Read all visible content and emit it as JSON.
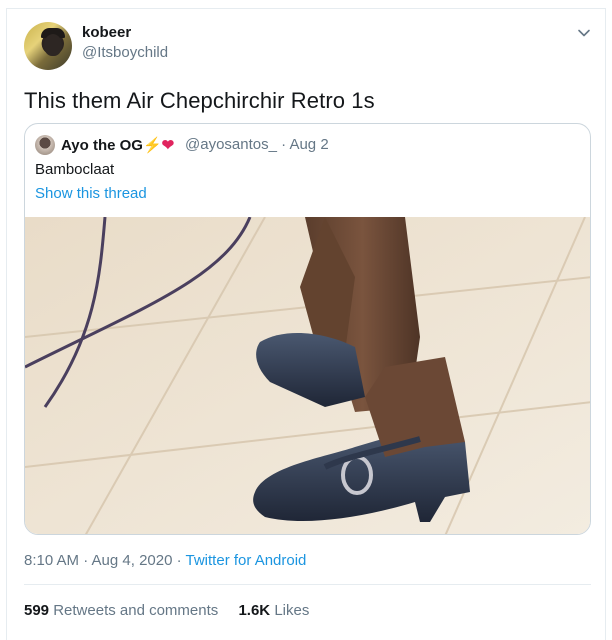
{
  "author": {
    "display_name": "kobeer",
    "handle": "@Itsboychild",
    "avatar_icon": "avatar-icon"
  },
  "tweet": {
    "text": "This them Air Chepchirchir Retro 1s"
  },
  "quoted": {
    "display_name": "Ayo the OG",
    "emoji_bolt": "⚡",
    "emoji_heart": "❤",
    "handle": "@ayosantos_",
    "date": "· Aug 2",
    "text": "Bamboclaat",
    "show_thread": "Show this thread"
  },
  "meta": {
    "time_date": "8:10 AM · Aug 4, 2020 ·",
    "source": "Twitter for Android"
  },
  "stats": {
    "retweets_count": "599",
    "retweets_label": "Retweets and comments",
    "likes_count": "1.6K",
    "likes_label": "Likes"
  },
  "colors": {
    "link": "#1b95e0",
    "secondary_text": "#657786",
    "primary_text": "#14171a",
    "border": "#ccd6dd"
  }
}
